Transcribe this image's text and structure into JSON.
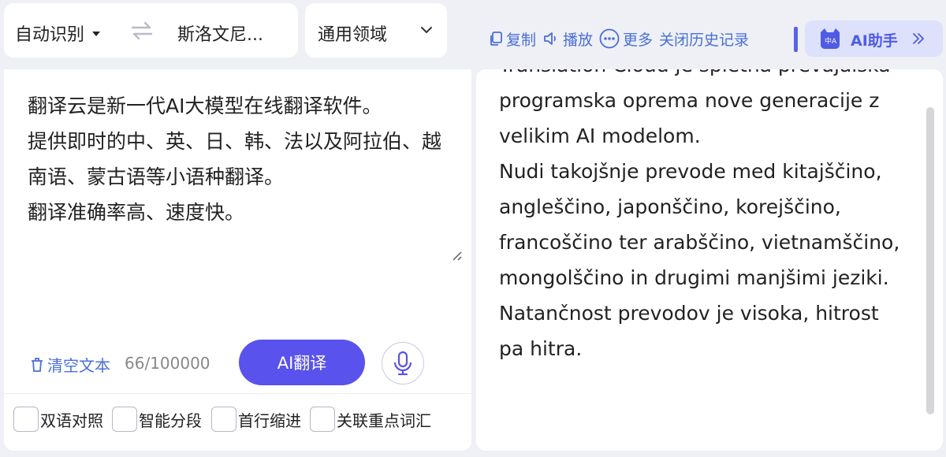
{
  "language_bar": {
    "source_language": "自动识别",
    "target_language": "斯洛文尼..."
  },
  "domain": {
    "selected": "通用领域"
  },
  "toolbar": {
    "copy_label": "复制",
    "play_label": "播放",
    "more_label": "更多",
    "history_label": "关闭历史记录",
    "ai_assistant_label": "AI助手"
  },
  "source": {
    "text": "翻译云是新一代AI大模型在线翻译软件。\n提供即时的中、英、日、韩、法以及阿拉伯、越南语、蒙古语等小语种翻译。\n翻译准确率高、速度快。",
    "clear_label": "清空文本",
    "char_count": "66/100000",
    "translate_label": "AI翻译"
  },
  "options": [
    {
      "label": "双语对照",
      "checked": false
    },
    {
      "label": "智能分段",
      "checked": false
    },
    {
      "label": "首行缩进",
      "checked": false
    },
    {
      "label": "关联重点词汇",
      "checked": false
    }
  ],
  "target": {
    "text": "Translation Cloud je spletna prevajalska programska oprema nove generacije z velikim AI modelom.\nNudi takojšnje prevode med kitajščino, angleščino, japonščino, korejščino, francoščino ter arabščino, vietnamščino, mongolščino in drugimi manjšimi jeziki.\nNatančnost prevodov je visoka, hitrost pa hitra."
  },
  "colors": {
    "accent": "#5a52ec",
    "link": "#4a6fd8",
    "background": "#eef0f6"
  }
}
